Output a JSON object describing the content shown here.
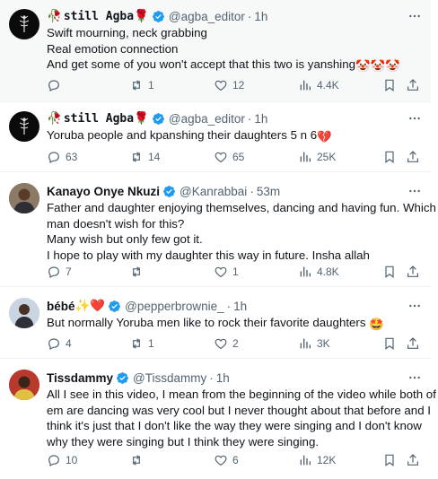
{
  "tweets": [
    {
      "display_name": "still Agba",
      "name_prefix_emoji": "🥀",
      "name_suffix_emoji": "🌹",
      "handle": "@agba_editor",
      "dot": "·",
      "time": "1h",
      "lines": [
        "Swift mourning, neck grabbing",
        "Real emotion connection",
        "And get some of you won't accept that this two is yanshing"
      ],
      "trailing_emojis": "🤡🤡🤡",
      "replies": "",
      "reposts": "1",
      "likes": "12",
      "views": "4.4K"
    },
    {
      "display_name": "still Agba",
      "name_prefix_emoji": "🥀",
      "name_suffix_emoji": "🌹",
      "handle": "@agba_editor",
      "dot": "·",
      "time": "1h",
      "lines": [
        "Yoruba people and kpanshing their daughters 5 n 6"
      ],
      "trailing_emojis": "💔",
      "replies": "63",
      "reposts": "14",
      "likes": "65",
      "views": "25K"
    },
    {
      "display_name": "Kanayo Onye Nkuzi",
      "handle": "@Kanrabbai",
      "dot": "·",
      "time": "53m",
      "lines": [
        "Father and daughter enjoying themselves, dancing and having fun. Which",
        "man doesn't wish for this?",
        "Many wish but only few got it.",
        "I hope to play with my daughter this way in future. Insha allah"
      ],
      "replies": "7",
      "reposts": "",
      "likes": "1",
      "views": "4.8K"
    },
    {
      "display_name": "bébé",
      "name_suffix_emoji": "✨❤️",
      "handle": "@pepperbrownie_",
      "dot": "·",
      "time": "1h",
      "lines": [
        "But normally Yoruba men like to rock their favorite daughters"
      ],
      "trailing_emojis": "🤩",
      "replies": "4",
      "reposts": "1",
      "likes": "2",
      "views": "3K"
    },
    {
      "display_name": "Tissdammy",
      "handle": "@Tissdammy",
      "dot": "·",
      "time": "1h",
      "lines": [
        "All I see in this video, I mean from the beginning of the video while both of",
        "em are dancing was very cool but I never thought about that before and I",
        "think it's just that I don't like the way they were singing and I don't know",
        "why they were singing but I think they were singing."
      ],
      "replies": "10",
      "reposts": "",
      "likes": "6",
      "views": "12K"
    }
  ],
  "icons": {
    "verified": "verified-badge-icon",
    "more": "more-dots-icon",
    "reply": "reply-bubble-icon",
    "repost": "repost-arrows-icon",
    "like": "heart-icon",
    "views": "views-bars-icon",
    "bookmark": "bookmark-icon",
    "share": "share-icon"
  },
  "colors": {
    "verified_blue": "#1d9bf0",
    "secondary_text": "#536471",
    "primary_text": "#0f1419",
    "highlight_bg": "#f7f9f9"
  }
}
